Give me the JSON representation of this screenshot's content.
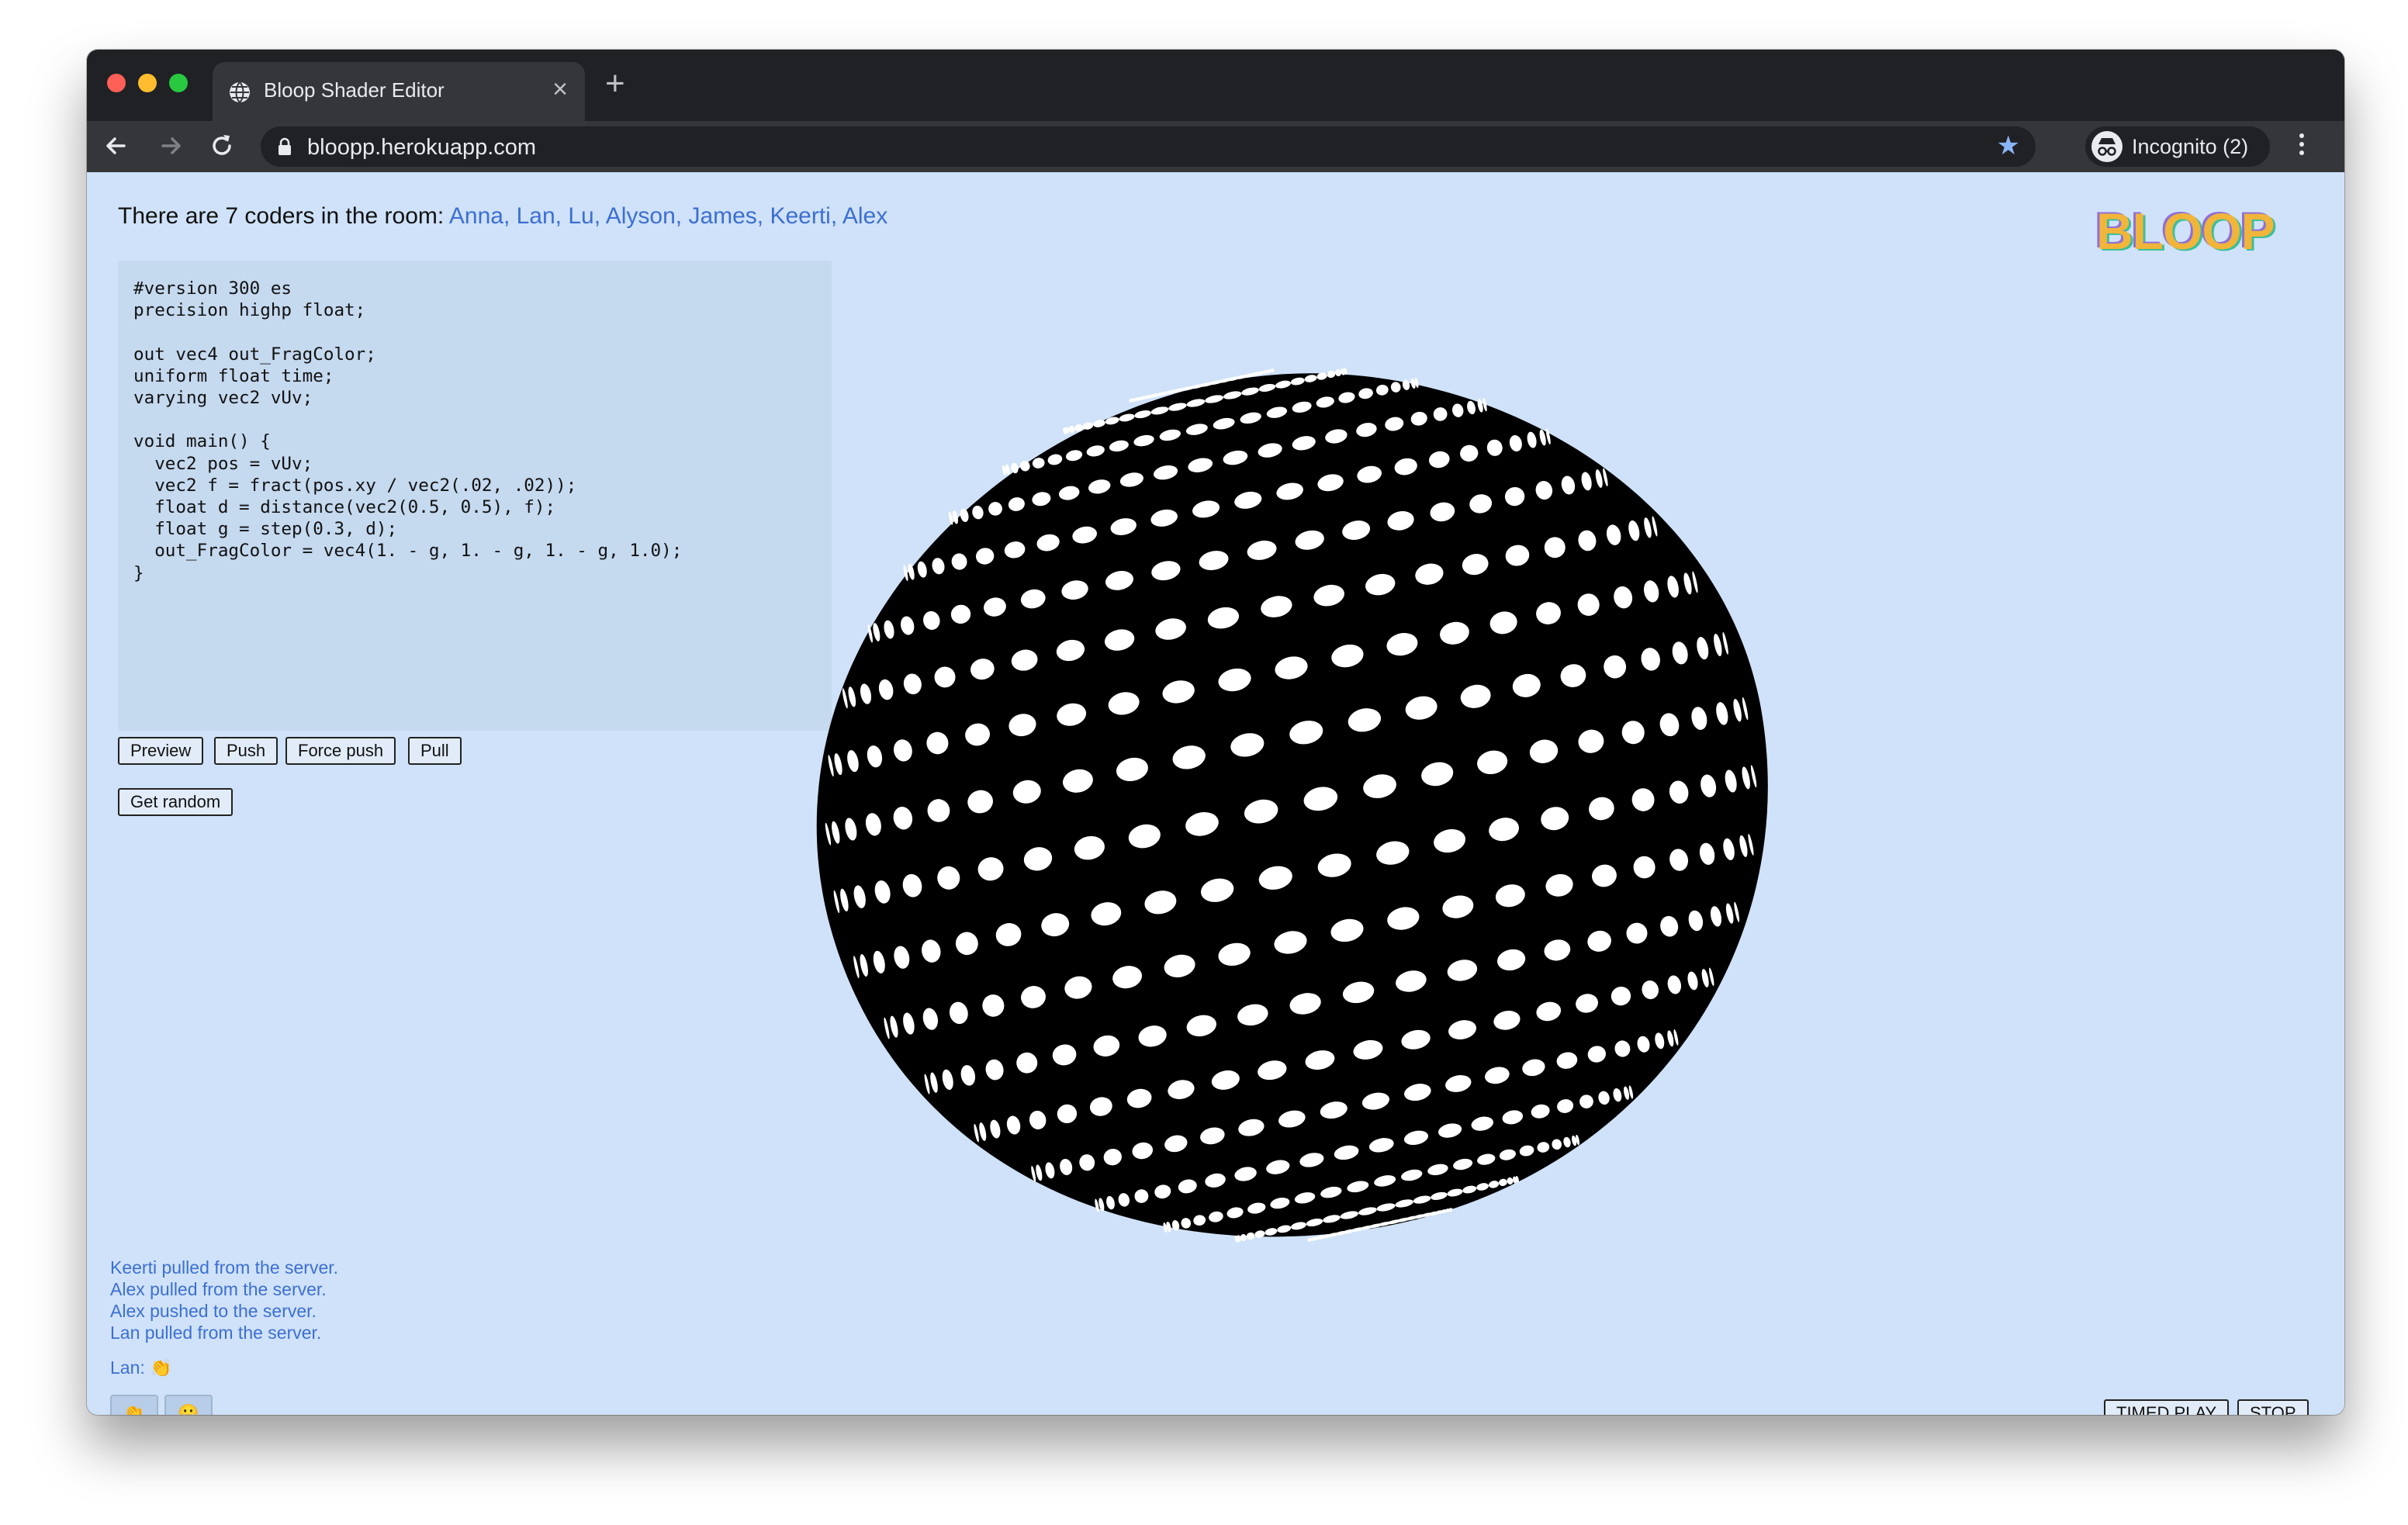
{
  "browser": {
    "tab_title": "Bloop Shader Editor",
    "tab_close": "×",
    "new_tab": "+",
    "url": "bloopp.herokuapp.com",
    "incognito_label": "Incognito (2)",
    "bookmark_star": "★",
    "icons": [
      "globe-icon",
      "back-arrow-icon",
      "forward-arrow-icon",
      "reload-icon",
      "lock-icon",
      "star-icon",
      "incognito-icon",
      "more-vert-icon"
    ],
    "colors": {
      "traffic_red": "#fe5f57",
      "traffic_yellow": "#febc2e",
      "traffic_green": "#28c840",
      "star": "#8ab4f8"
    }
  },
  "header": {
    "room_prefix": "There are 7 coders in the room: ",
    "room_names": "Anna, Lan, Lu, Alyson, James, Keerti, Alex",
    "logo": "BLOOP"
  },
  "editor": {
    "code": "#version 300 es\nprecision highp float;\n\nout vec4 out_FragColor;\nuniform float time;\nvarying vec2 vUv;\n\nvoid main() {\n  vec2 pos = vUv;\n  vec2 f = fract(pos.xy / vec2(.02, .02));\n  float d = distance(vec2(0.5, 0.5), f);\n  float g = step(0.3, d);\n  out_FragColor = vec4(1. - g, 1. - g, 1. - g, 1.0);\n}"
  },
  "buttons": {
    "preview": "Preview",
    "push": "Push",
    "force_push": "Force push",
    "pull": "Pull",
    "get_random": "Get random",
    "timed_play": "TIMED PLAY",
    "stop": "STOP"
  },
  "log": [
    "Keerti pulled from the server.",
    "Alex pulled from the server.",
    "Alex pushed to the server.",
    "Lan pulled from the server."
  ],
  "chat": {
    "line": "Lan: 👏"
  },
  "reactions": [
    {
      "emoji": "👏",
      "icon": "clap-icon"
    },
    {
      "emoji": "😀",
      "icon": "smile-icon"
    }
  ],
  "colors": {
    "page_bg": "#cfe2f9",
    "link": "#3d6fd1",
    "editor_bg": "#c5d9ef"
  }
}
